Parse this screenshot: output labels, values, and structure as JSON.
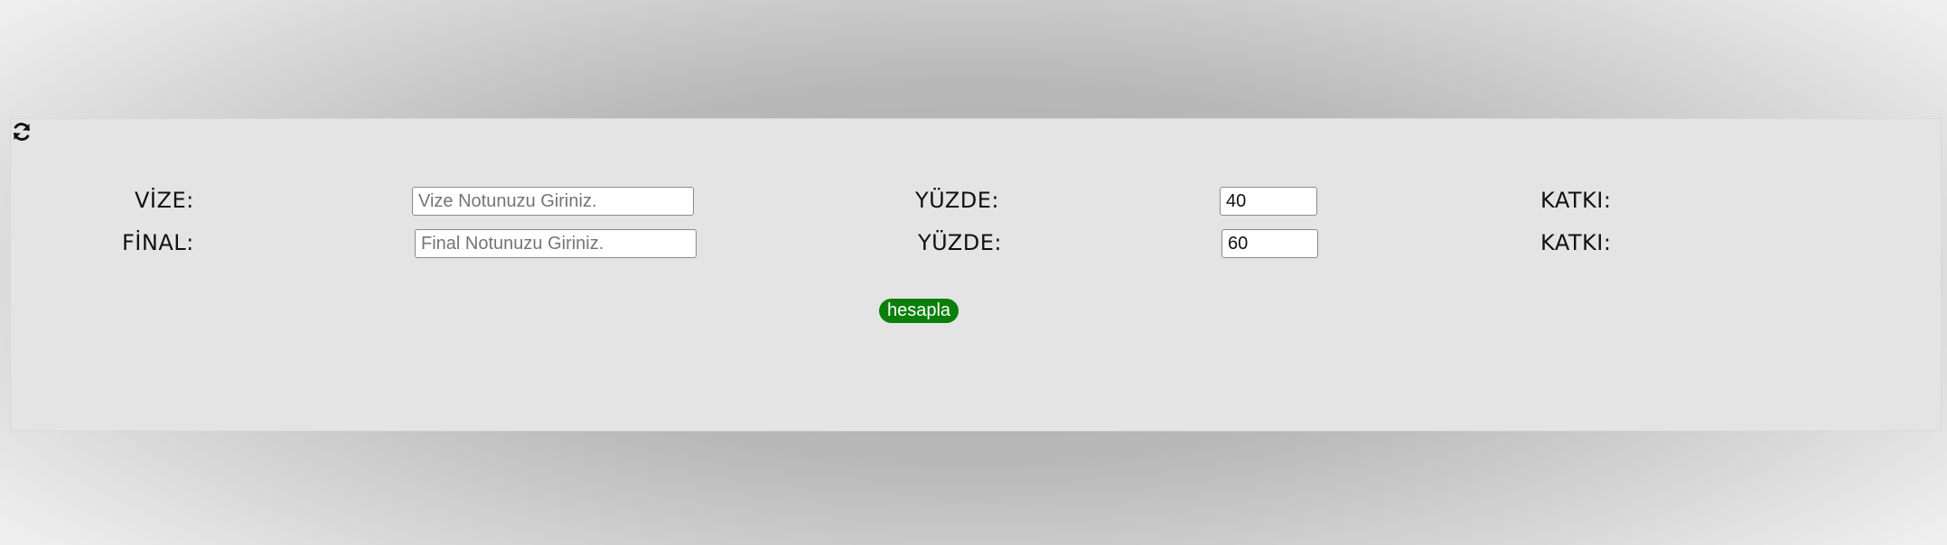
{
  "form": {
    "refresh_icon": "refresh-icon",
    "rows": [
      {
        "label": "VİZE:",
        "input_placeholder": "Vize Notunuzu Giriniz.",
        "input_value": "",
        "percent_label": "YÜZDE:",
        "percent_value": "40",
        "contribution_label": "KATKI:"
      },
      {
        "label": "FİNAL:",
        "input_placeholder": "Final Notunuzu Giriniz.",
        "input_value": "",
        "percent_label": "YÜZDE:",
        "percent_value": "60",
        "contribution_label": "KATKI:"
      }
    ],
    "calculate_label": "hesapla"
  },
  "colors": {
    "panel": "#e4e4e4",
    "button": "#0a7f0a",
    "button_text": "#ffffff"
  }
}
